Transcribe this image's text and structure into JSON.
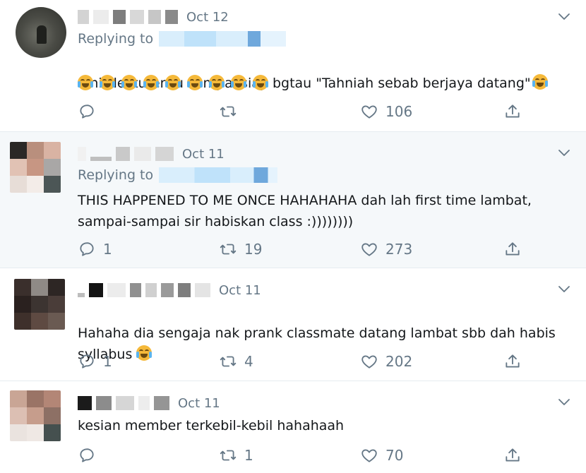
{
  "tweets": [
    {
      "date": "Oct 12",
      "replying_label": "Replying to",
      "text": "Sinis lecturer tu sampai siap bgtau \"Tahniah sebab berjaya datang\"",
      "emoji_count": 9,
      "reply_count": "",
      "retweet_count": "",
      "like_count": "106"
    },
    {
      "date": "Oct 11",
      "replying_label": "Replying to",
      "text": "THIS HAPPENED TO ME ONCE HAHAHAHA dah lah first time lambat,\nsampai-sampai sir habiskan class :))))))))",
      "reply_count": "1",
      "retweet_count": "19",
      "like_count": "273"
    },
    {
      "date": "Oct 11",
      "text": "Hahaha dia sengaja nak prank classmate datang lambat sbb dah habis\nsyllabus",
      "reply_count": "1",
      "retweet_count": "4",
      "like_count": "202"
    },
    {
      "date": "Oct 11",
      "text": "kesian member terkebil-kebil hahahaah",
      "reply_count": "",
      "retweet_count": "1",
      "like_count": "70"
    }
  ],
  "icons": {
    "reply": "reply-icon",
    "retweet": "retweet-icon",
    "like": "heart-icon",
    "share": "share-icon",
    "caret": "chevron-down-icon",
    "emoji": "face-with-tears-of-joy-emoji"
  },
  "colors": {
    "muted": "#657786",
    "text": "#14171a",
    "highlight_bg": "#f5f8fa",
    "divider": "#e6ecf0",
    "mask_blue": "#9fd3f7"
  }
}
